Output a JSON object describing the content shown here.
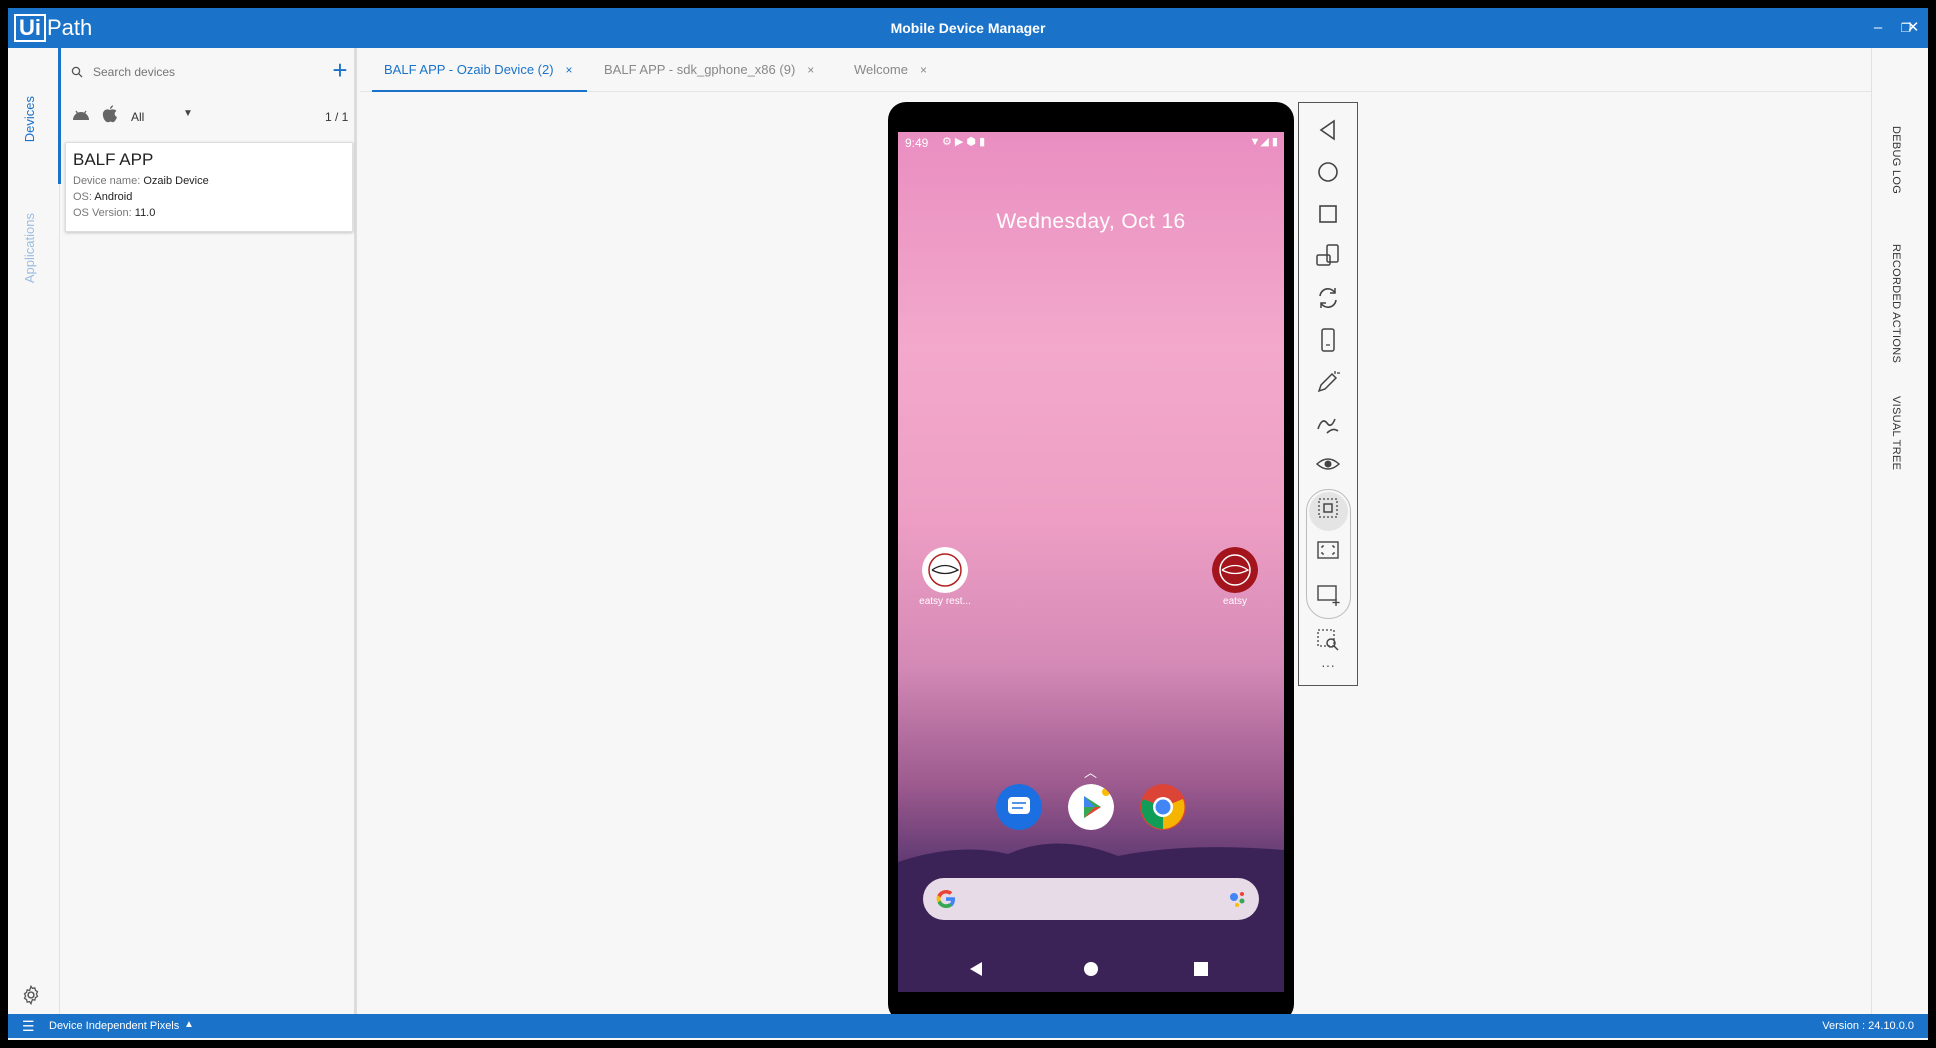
{
  "titlebar": {
    "logo_ui": "Ui",
    "logo_path": "Path",
    "title": "Mobile Device Manager",
    "minimize": "–",
    "restore": "❐",
    "close": "✕"
  },
  "leftrail": {
    "devices": "Devices",
    "applications": "Applications"
  },
  "devpanel": {
    "search_placeholder": "Search devices",
    "add": "+",
    "filter_all": "All",
    "count": "1 / 1",
    "device": {
      "name": "BALF APP",
      "device_name_label": "Device name:",
      "device_name": "Ozaib Device",
      "os_label": "OS:",
      "os": "Android",
      "os_version_label": "OS Version:",
      "os_version": "11.0"
    }
  },
  "tabs": [
    {
      "label": "BALF APP - Ozaib Device (2)",
      "active": true
    },
    {
      "label": "BALF APP - sdk_gphone_x86 (9)",
      "active": false
    },
    {
      "label": "Welcome",
      "active": false
    }
  ],
  "tab_close": "×",
  "phone": {
    "time": "9:49",
    "date": "Wednesday, Oct 16",
    "apps": [
      {
        "label": "eatsy rest..."
      },
      {
        "label": "eatsy"
      }
    ],
    "swipe_up": "︿"
  },
  "toolbar": {
    "more": "···"
  },
  "rightrail": {
    "debug_log": "DEBUG LOG",
    "recorded_actions": "RECORDED ACTIONS",
    "visual_tree": "VISUAL TREE"
  },
  "statusbar": {
    "units": "Device Independent Pixels",
    "version": "Version : 24.10.0.0"
  },
  "colors": {
    "accent": "#1a73c9"
  }
}
